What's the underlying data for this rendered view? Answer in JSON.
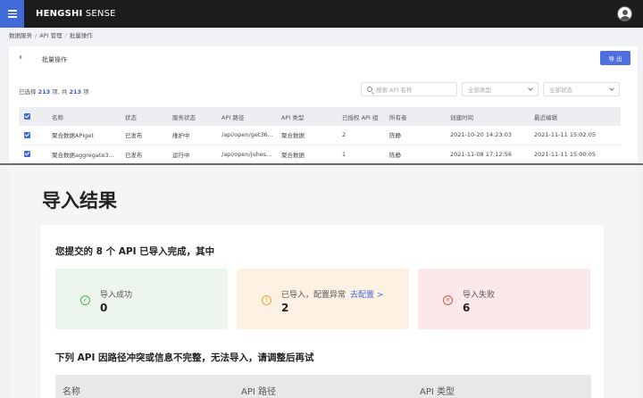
{
  "header": {
    "brand_bold": "HENGSHI",
    "brand_light": " SENSE"
  },
  "breadcrumb": [
    "数据服务",
    "API 管理",
    "批量操作"
  ],
  "toolbar": {
    "back_icon": "‹",
    "title": "批量操作",
    "export_label": "导 出"
  },
  "selection": {
    "prefix": "已选择 ",
    "count": "213",
    "middle": " 项, 共 ",
    "total": "213",
    "suffix": " 项"
  },
  "filters": {
    "search_placeholder": "搜索 API 名称",
    "type_placeholder": "全部类型",
    "status_placeholder": "全部状态"
  },
  "table": {
    "columns": [
      "名称",
      "状态",
      "服务状态",
      "API 路径",
      "API 类型",
      "已授权 API 组",
      "所有者",
      "创建时间",
      "最近编辑"
    ],
    "rows": [
      [
        "聚合数据APIget",
        "已发布",
        "维护中",
        "/api/open/get36...",
        "聚合数据",
        "2",
        "陈静",
        "2021-10-20 14:23:03",
        "2021-11-11 15:02:05"
      ],
      [
        "聚合数据aggregate3...",
        "已发布",
        "运行中",
        "/api/open/juhes...",
        "聚合数据",
        "1",
        "陈静",
        "2021-11-08 17:12:56",
        "2021-11-11 15:00:05"
      ]
    ]
  },
  "result": {
    "title": "导入结果",
    "summary": "您提交的 8 个 API 已导入完成，其中",
    "stats": {
      "success": {
        "label": "导入成功",
        "value": "0",
        "icon": "✓"
      },
      "warn": {
        "label": "已导入，配置异常",
        "link": "去配置 >",
        "value": "2",
        "icon": "!"
      },
      "fail": {
        "label": "导入失败",
        "value": "6",
        "icon": "×"
      }
    },
    "fail_title": "下列 API 因路径冲突或信息不完整，无法导入，请调整后再试",
    "fail_columns": [
      "名称",
      "API 路径",
      "API 类型"
    ]
  },
  "colors": {
    "accent": "#3f6ad8",
    "topbar": "#1c1c1e",
    "success": "#4caf50",
    "warn": "#f0a030",
    "fail": "#e05050"
  }
}
